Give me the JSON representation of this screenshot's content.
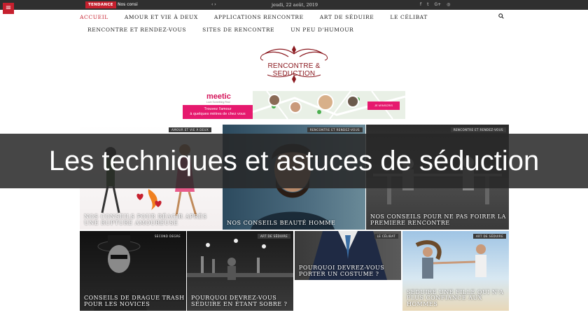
{
  "topbar": {
    "menu_icon": "hamburger-icon",
    "tendance_label": "TENDANCE",
    "ticker_text": "Nos consi",
    "ticker_nav": "‹ ›",
    "date": "jeudi, 22 août, 2019",
    "social": [
      {
        "icon": "facebook-icon",
        "glyph": "f"
      },
      {
        "icon": "twitter-icon",
        "glyph": "t"
      },
      {
        "icon": "google-plus-icon",
        "glyph": "G+"
      },
      {
        "icon": "instagram-icon",
        "glyph": "◎"
      }
    ]
  },
  "nav": {
    "row1": [
      "ACCUEIL",
      "AMOUR ET VIE À DEUX",
      "APPLICATIONS RENCONTRE",
      "ART DE SÉDUIRE",
      "LE CÉLIBAT"
    ],
    "row2": [
      "RENCONTRE ET RENDEZ-VOUS",
      "SITES DE RENCONTRE",
      "UN PEU D'HUMOUR"
    ],
    "search_icon": "search-icon"
  },
  "logo": {
    "text": "RENCONTRE & SEDUCTION"
  },
  "ad": {
    "brand": "meetic",
    "tagline": "Love Something Real",
    "pitch_line1": "Trouvez l'amour",
    "pitch_line2": "à quelques mètres de chez vous",
    "cta": "JE M'INSCRIS"
  },
  "tiles": [
    {
      "badge": "AMOUR ET VIE À DEUX",
      "title": "NOS CONSEILS POUR RÉAGIR APRÈS UNE RUPTURE AMOUREUSE"
    },
    {
      "badge": "RENCONTRE ET RENDEZ-VOUS",
      "title": "NOS CONSEILS BEAUTÉ HOMME"
    },
    {
      "badge": "RENCONTRE ET RENDEZ-VOUS",
      "title": "NOS CONSEILS POUR NE PAS FOIRER LA PREMIERE RENCONTRE"
    },
    {
      "badge": "SECOND DEGRE",
      "title": "CONSEILS DE DRAGUE TRASH POUR LES NOVICES"
    },
    {
      "badge": "ART DE SÉDUIRE",
      "title": "POURQUOI DEVREZ-VOUS SÉDUIRE EN ÉTANT SOBRE ?"
    },
    {
      "badge": "LE CÉLIBAT",
      "title": "POURQUOI DEVREZ-VOUS PORTER UN COSTUME ?"
    },
    {
      "badge": "ART DE SÉDUIRE",
      "title": "SEDUIRE UNE FILLE QUI N'A PLUS CONFIANCE AUX HOMMES"
    }
  ],
  "hero": {
    "title": "Les techniques et astuces de séduction"
  },
  "colors": {
    "accent": "#c6202e",
    "topbar": "#2f2f2f",
    "ad_pink": "#e6196e"
  }
}
